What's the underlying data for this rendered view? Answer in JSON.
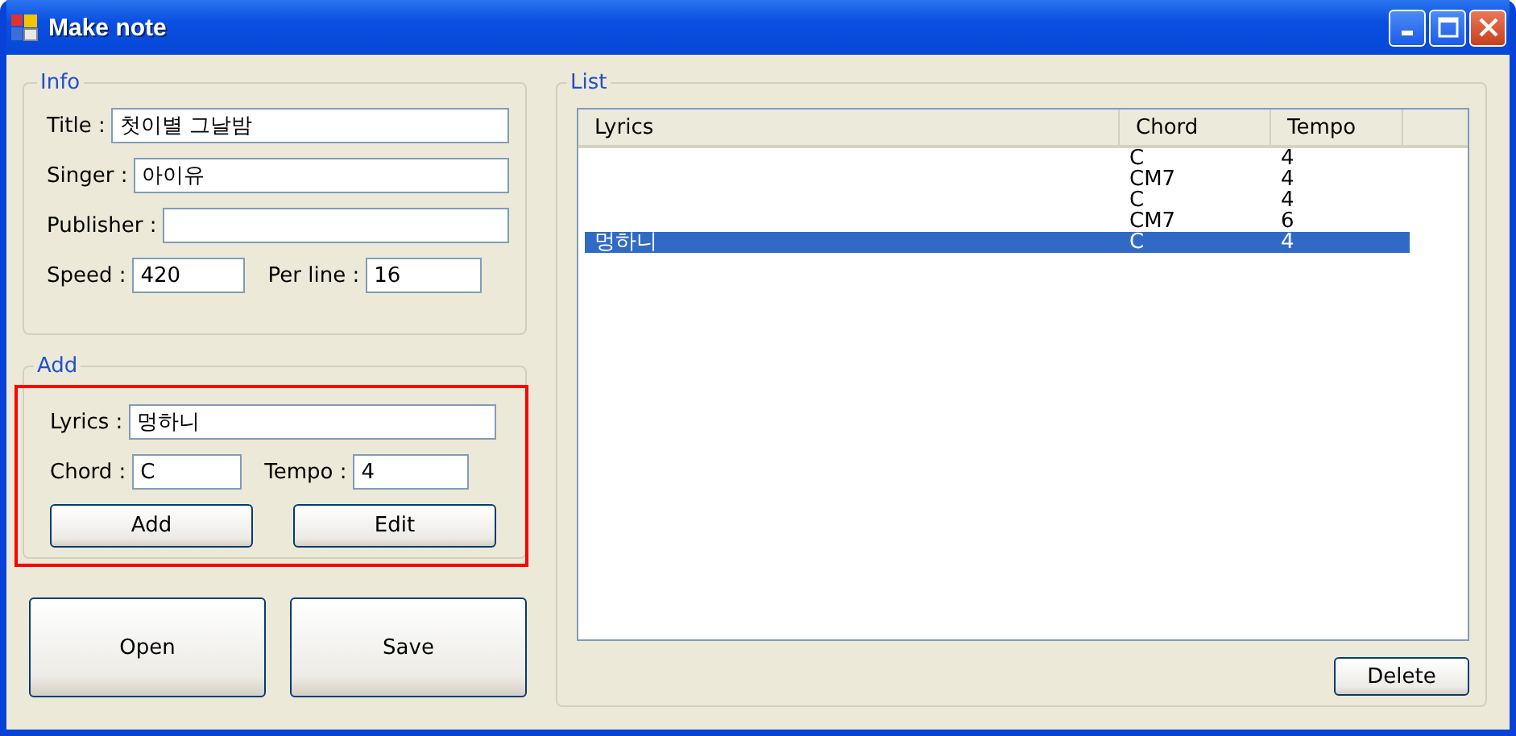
{
  "window": {
    "title": "Make note"
  },
  "info": {
    "legend": "Info",
    "title": {
      "label": "Title :",
      "value": "첫이별 그날밤"
    },
    "singer": {
      "label": "Singer :",
      "value": "아이유"
    },
    "publisher": {
      "label": "Publisher :"
    },
    "speed": {
      "label": "Speed :",
      "value": "420"
    },
    "per_line": {
      "label": "Per line :",
      "value": "16"
    }
  },
  "add": {
    "legend": "Add",
    "lyrics": {
      "label": "Lyrics :",
      "value": "멍하니"
    },
    "chord": {
      "label": "Chord :",
      "value": "C"
    },
    "tempo": {
      "label": "Tempo :",
      "value": "4"
    },
    "buttons": [
      "Add",
      "Edit"
    ]
  },
  "buttons": [
    "Open",
    "Save"
  ],
  "list": {
    "legend": "List",
    "columns": [
      "Lyrics",
      "Chord",
      "Tempo"
    ],
    "rows": [
      {
        "lyrics": "",
        "chord": "C",
        "tempo": "4",
        "selected": false
      },
      {
        "lyrics": "",
        "chord": "CM7",
        "tempo": "4",
        "selected": false
      },
      {
        "lyrics": "",
        "chord": "C",
        "tempo": "4",
        "selected": false
      },
      {
        "lyrics": "",
        "chord": "CM7",
        "tempo": "6",
        "selected": false
      },
      {
        "lyrics": "멍하니",
        "chord": "C",
        "tempo": "4",
        "selected": true
      }
    ],
    "delete_button": "Delete"
  }
}
